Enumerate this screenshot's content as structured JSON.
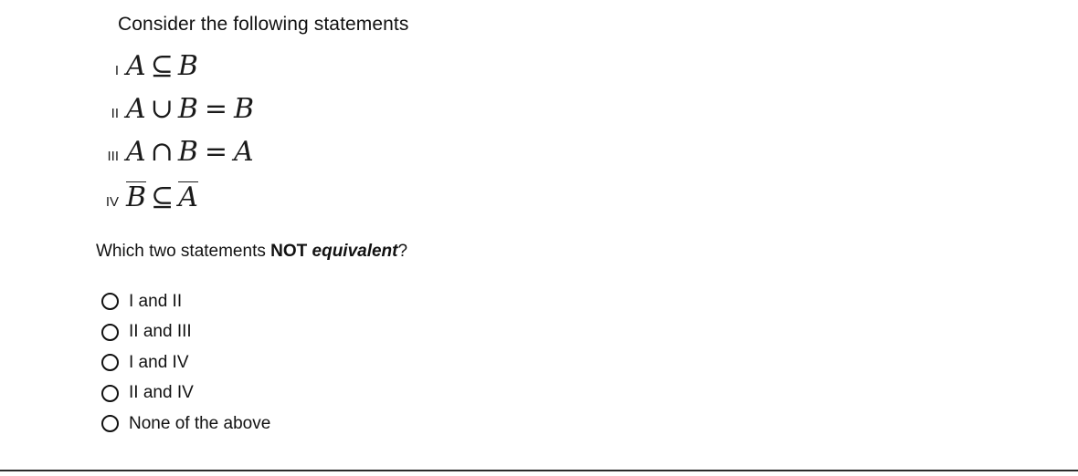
{
  "prompt": "Consider the following statements",
  "statements": [
    {
      "roman": "I",
      "text": "A ⊆ B",
      "left": "A",
      "operator": "⊆",
      "right": "B",
      "left_bar": false,
      "right_bar": false,
      "equals": "",
      "result": ""
    },
    {
      "roman": "II",
      "text": "A ∪ B = B",
      "left": "A",
      "operator": "∪",
      "right": "B",
      "left_bar": false,
      "right_bar": false,
      "equals": "=",
      "result": "B"
    },
    {
      "roman": "III",
      "text": "A ∩ B = A",
      "left": "A",
      "operator": "∩",
      "right": "B",
      "left_bar": false,
      "right_bar": false,
      "equals": "=",
      "result": "A"
    },
    {
      "roman": "IV",
      "text": "B̅ ⊆ A̅",
      "left": "B",
      "operator": "⊆",
      "right": "A",
      "left_bar": true,
      "right_bar": true,
      "equals": "",
      "result": ""
    }
  ],
  "question": {
    "lead": "Which two statements ",
    "bold": "NOT",
    "space": " ",
    "bold_italic": "equivalent",
    "trail": "?"
  },
  "options": [
    {
      "label": "I and II",
      "selected": false
    },
    {
      "label": "II and III",
      "selected": false
    },
    {
      "label": "I and IV",
      "selected": false
    },
    {
      "label": "II and IV",
      "selected": false
    },
    {
      "label": "None of the above",
      "selected": false
    }
  ],
  "colors": {
    "text": "#111111",
    "math": "#1a1a1a",
    "divider": "#2b2b2b",
    "background": "#ffffff"
  }
}
